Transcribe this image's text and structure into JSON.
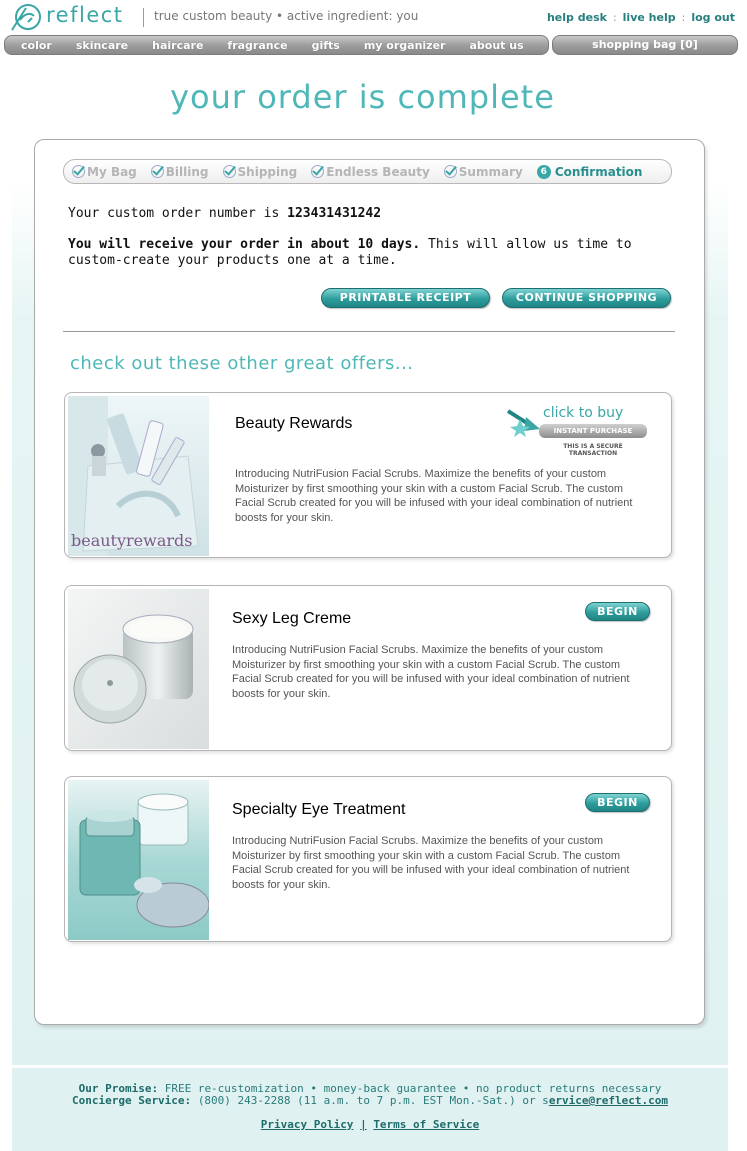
{
  "brand": {
    "name": "reflect",
    "tagline": "true custom beauty • active ingredient: you"
  },
  "utility_links": [
    "help desk",
    "live help",
    "log out"
  ],
  "nav": {
    "items": [
      "color",
      "skincare",
      "haircare",
      "fragrance",
      "gifts",
      "my organizer",
      "about us"
    ],
    "bag": "shopping bag [0]"
  },
  "page_title": "your order is complete",
  "steps": {
    "completed": [
      "My Bag",
      "Billing",
      "Shipping",
      "Endless Beauty",
      "Summary"
    ],
    "current_number": "6",
    "current": "Confirmation"
  },
  "order": {
    "number_label": "Your custom order number is",
    "number": "123431431242",
    "eta_bold": "You will receive your order in about 10 days.",
    "eta_rest": "This will allow us time to custom-create your products one at a time."
  },
  "buttons": {
    "receipt": "PRINTABLE RECEIPT",
    "continue": "CONTINUE SHOPPING"
  },
  "offers_title": "check out these other great offers...",
  "offers": [
    {
      "title": "Beauty Rewards",
      "description": "Introducing NutriFusion Facial Scrubs. Maximize the benefits of your custom Moisturizer by first smoothing your skin with a custom Facial Scrub. The custom Facial Scrub created for you will be infused with your ideal combination of nutrient boosts for your skin.",
      "image_caption": "beautyrewards",
      "cta": {
        "label": "click to buy",
        "bar": "INSTANT PURCHASE",
        "sub": "THIS IS A SECURE TRANSACTION"
      }
    },
    {
      "title": "Sexy Leg Creme",
      "description": "Introducing NutriFusion Facial Scrubs. Maximize the benefits of your custom Moisturizer by first smoothing your skin with a custom Facial Scrub. The custom Facial Scrub created for you will be infused with your ideal combination of nutrient boosts for your skin.",
      "button": "BEGIN"
    },
    {
      "title": "Specialty Eye Treatment",
      "description": "Introducing NutriFusion Facial Scrubs. Maximize the benefits of your custom Moisturizer by first smoothing your skin with a custom Facial Scrub. The custom Facial Scrub created for you will be infused with your ideal combination of nutrient boosts for your skin.",
      "button": "BEGIN"
    }
  ],
  "footer": {
    "promise_label": "Our Promise:",
    "promise_text": "FREE re-customization • money-back guarantee • no product returns necessary",
    "concierge_label": "Concierge Service:",
    "concierge_text": "(800) 243-2288 (11 a.m. to 7 p.m. EST Mon.-Sat.) or s",
    "email": "ervice@reflect.com",
    "privacy": "Privacy Policy",
    "separator": "|",
    "terms": "Terms of Service"
  },
  "colors": {
    "accent": "#3aa6a6",
    "nav_gray": "#9b9b9b",
    "band": "#dff2f1"
  }
}
